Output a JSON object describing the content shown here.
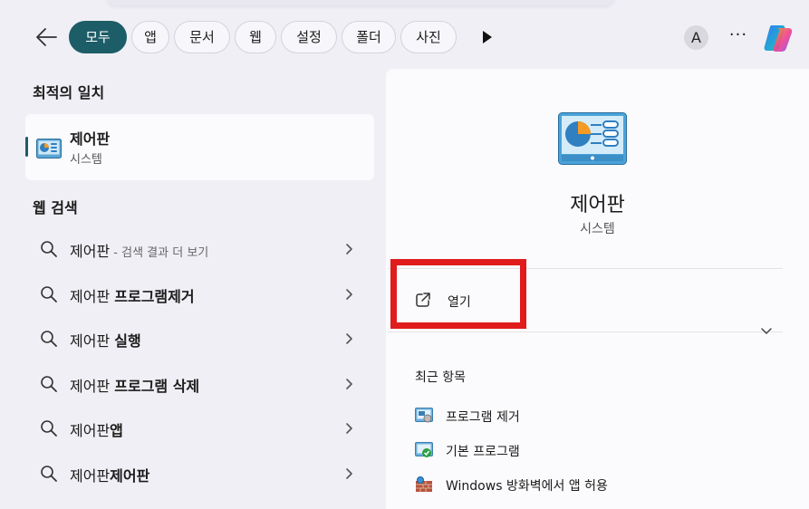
{
  "filters": {
    "back_label": "",
    "tabs": [
      "모두",
      "앱",
      "문서",
      "웹",
      "설정",
      "폴더",
      "사진"
    ],
    "active_tab": "모두",
    "avatar_initial": "A",
    "more_label": "···"
  },
  "best_match": {
    "section_title": "최적의 일치",
    "name": "제어판",
    "subtitle": "시스템"
  },
  "web_search": {
    "section_title": "웹 검색",
    "results": [
      {
        "prefix": "제어판",
        "bold": "",
        "muted": " - 검색 결과 더 보기"
      },
      {
        "prefix": "제어판 ",
        "bold": "프로그램제거",
        "muted": ""
      },
      {
        "prefix": "제어판 ",
        "bold": "실행",
        "muted": ""
      },
      {
        "prefix": "제어판 ",
        "bold": "프로그램 삭제",
        "muted": ""
      },
      {
        "prefix": "제어판",
        "bold": "앱",
        "muted": ""
      },
      {
        "prefix": "제어판",
        "bold": "제어판",
        "muted": ""
      }
    ]
  },
  "detail": {
    "title": "제어판",
    "subtitle": "시스템",
    "open_label": "열기",
    "recent_title": "최근 항목",
    "recent_items": [
      {
        "label": "프로그램 제거",
        "icon": "uninstall-program-icon"
      },
      {
        "label": "기본 프로그램",
        "icon": "default-programs-icon"
      },
      {
        "label": "Windows 방화벽에서 앱 허용",
        "icon": "firewall-icon"
      }
    ]
  },
  "colors": {
    "accent": "#1d5d67",
    "highlight": "#e01c1c"
  }
}
